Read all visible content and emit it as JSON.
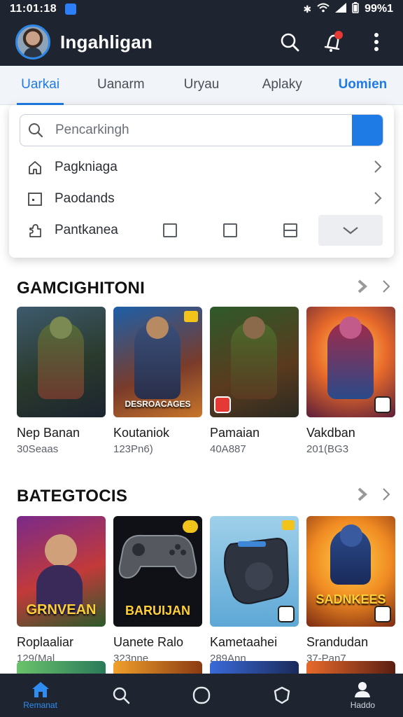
{
  "status_bar": {
    "time": "11:01:18",
    "battery": "99%1"
  },
  "header": {
    "title": "Ingahligan"
  },
  "tabs": [
    {
      "label": "Uarkai"
    },
    {
      "label": "Uanarm"
    },
    {
      "label": "Uryau"
    },
    {
      "label": "Aplaky"
    },
    {
      "label": "Uomien"
    }
  ],
  "dropdown": {
    "search_placeholder": "Pencarkingh",
    "items": [
      {
        "label": "Pagkniaga",
        "icon": "home-icon"
      },
      {
        "label": "Paodands",
        "icon": "window-icon"
      },
      {
        "label": "Pantkanea",
        "icon": "puzzle-icon"
      }
    ]
  },
  "sections": [
    {
      "title": "GAMCIGHITONI",
      "cards": [
        {
          "title": "Nep Banan",
          "subtitle": "30Seaas"
        },
        {
          "title": "Koutaniok",
          "subtitle": "123Pn6)",
          "banner": "DESROACAGES"
        },
        {
          "title": "Pamaian",
          "subtitle": "40A887"
        },
        {
          "title": "Vakdban",
          "subtitle": "201(BG3"
        }
      ]
    },
    {
      "title": "BATEGTOCIS",
      "cards": [
        {
          "title": "Roplaaliar",
          "subtitle": "129(Mal",
          "banner": "GRNVEAN"
        },
        {
          "title": "Uanete Ralo",
          "subtitle": "323nne",
          "banner": "BARUIJAN"
        },
        {
          "title": "Kametaahei",
          "subtitle": "289Ann"
        },
        {
          "title": "Srandudan",
          "subtitle": "37-Pan7",
          "banner": "SADNKEES"
        }
      ]
    }
  ],
  "bottom_nav": [
    {
      "label": "Remanat",
      "icon": "home-icon"
    },
    {
      "label": "",
      "icon": "search-icon"
    },
    {
      "label": "",
      "icon": "circle-icon"
    },
    {
      "label": "",
      "icon": "shield-icon"
    },
    {
      "label": "Haddo",
      "icon": "profile-icon"
    }
  ],
  "colors": {
    "accent": "#1e7be6",
    "bar": "#1f2530",
    "notification": "#e53935"
  }
}
